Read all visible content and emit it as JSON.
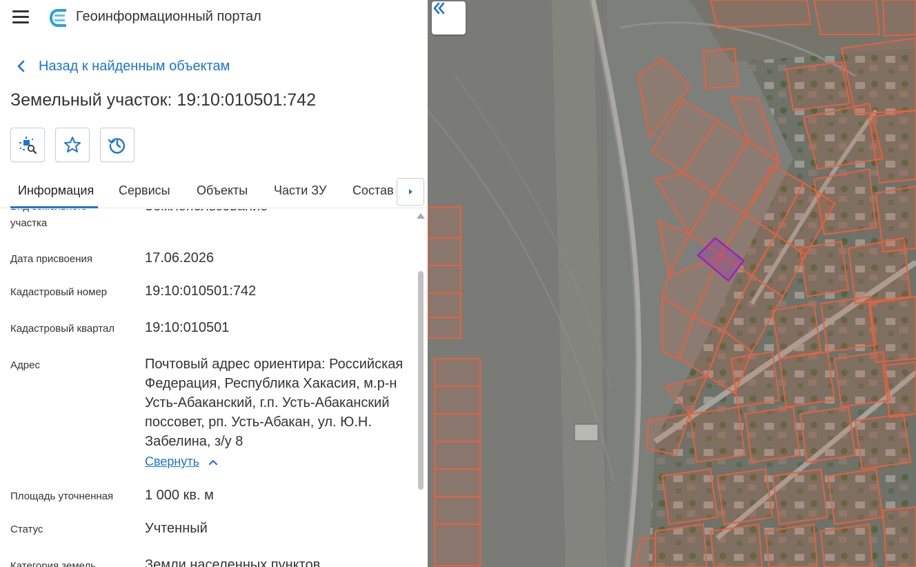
{
  "header": {
    "app_title": "Геоинформационный портал"
  },
  "nav": {
    "back_label": "Назад к найденным объектам"
  },
  "object": {
    "title": "Земельный участок: 19:10:010501:742"
  },
  "tabs": [
    {
      "label": "Информация",
      "active": true
    },
    {
      "label": "Сервисы",
      "active": false
    },
    {
      "label": "Объекты",
      "active": false
    },
    {
      "label": "Части ЗУ",
      "active": false
    },
    {
      "label": "Состав",
      "active": false
    }
  ],
  "info": {
    "permitted_use": {
      "label": "Вид земельного участка",
      "value": "Землепользование"
    },
    "assign_date": {
      "label": "Дата присвоения",
      "value": "17.06.2026"
    },
    "cadastral_number": {
      "label": "Кадастровый номер",
      "value": "19:10:010501:742"
    },
    "cadastral_block": {
      "label": "Кадастровый квартал",
      "value": "19:10:010501"
    },
    "address": {
      "label": "Адрес",
      "value": "Почтовый адрес ориентира: Российская Федерация, Республика Хакасия, м.р-н Усть-Абаканский, г.п. Усть-Абаканский поссовет, рп. Усть-Абакан, ул. Ю.Н. Забелина, з/у 8"
    },
    "collapse_label": "Свернуть",
    "area": {
      "label": "Площадь уточненная",
      "value": "1 000 кв. м"
    },
    "status": {
      "label": "Статус",
      "value": "Учтенный"
    },
    "land_category": {
      "label": "Категория земель",
      "value": "Земли населенных пунктов"
    }
  },
  "icons": {
    "menu": "hamburger-icon",
    "logo": "portal-logo-icon",
    "back": "chevron-left-icon",
    "locate": "map-locate-icon",
    "favorite": "star-icon",
    "history": "history-icon",
    "tabs_next": "caret-right-icon",
    "collapse_arrow": "chevron-up-icon",
    "collapse_panel": "double-chevron-left-icon"
  },
  "colors": {
    "accent": "#1a73d9",
    "parcel_outline": "#e8603c",
    "selected_parcel": "#a020c0"
  }
}
